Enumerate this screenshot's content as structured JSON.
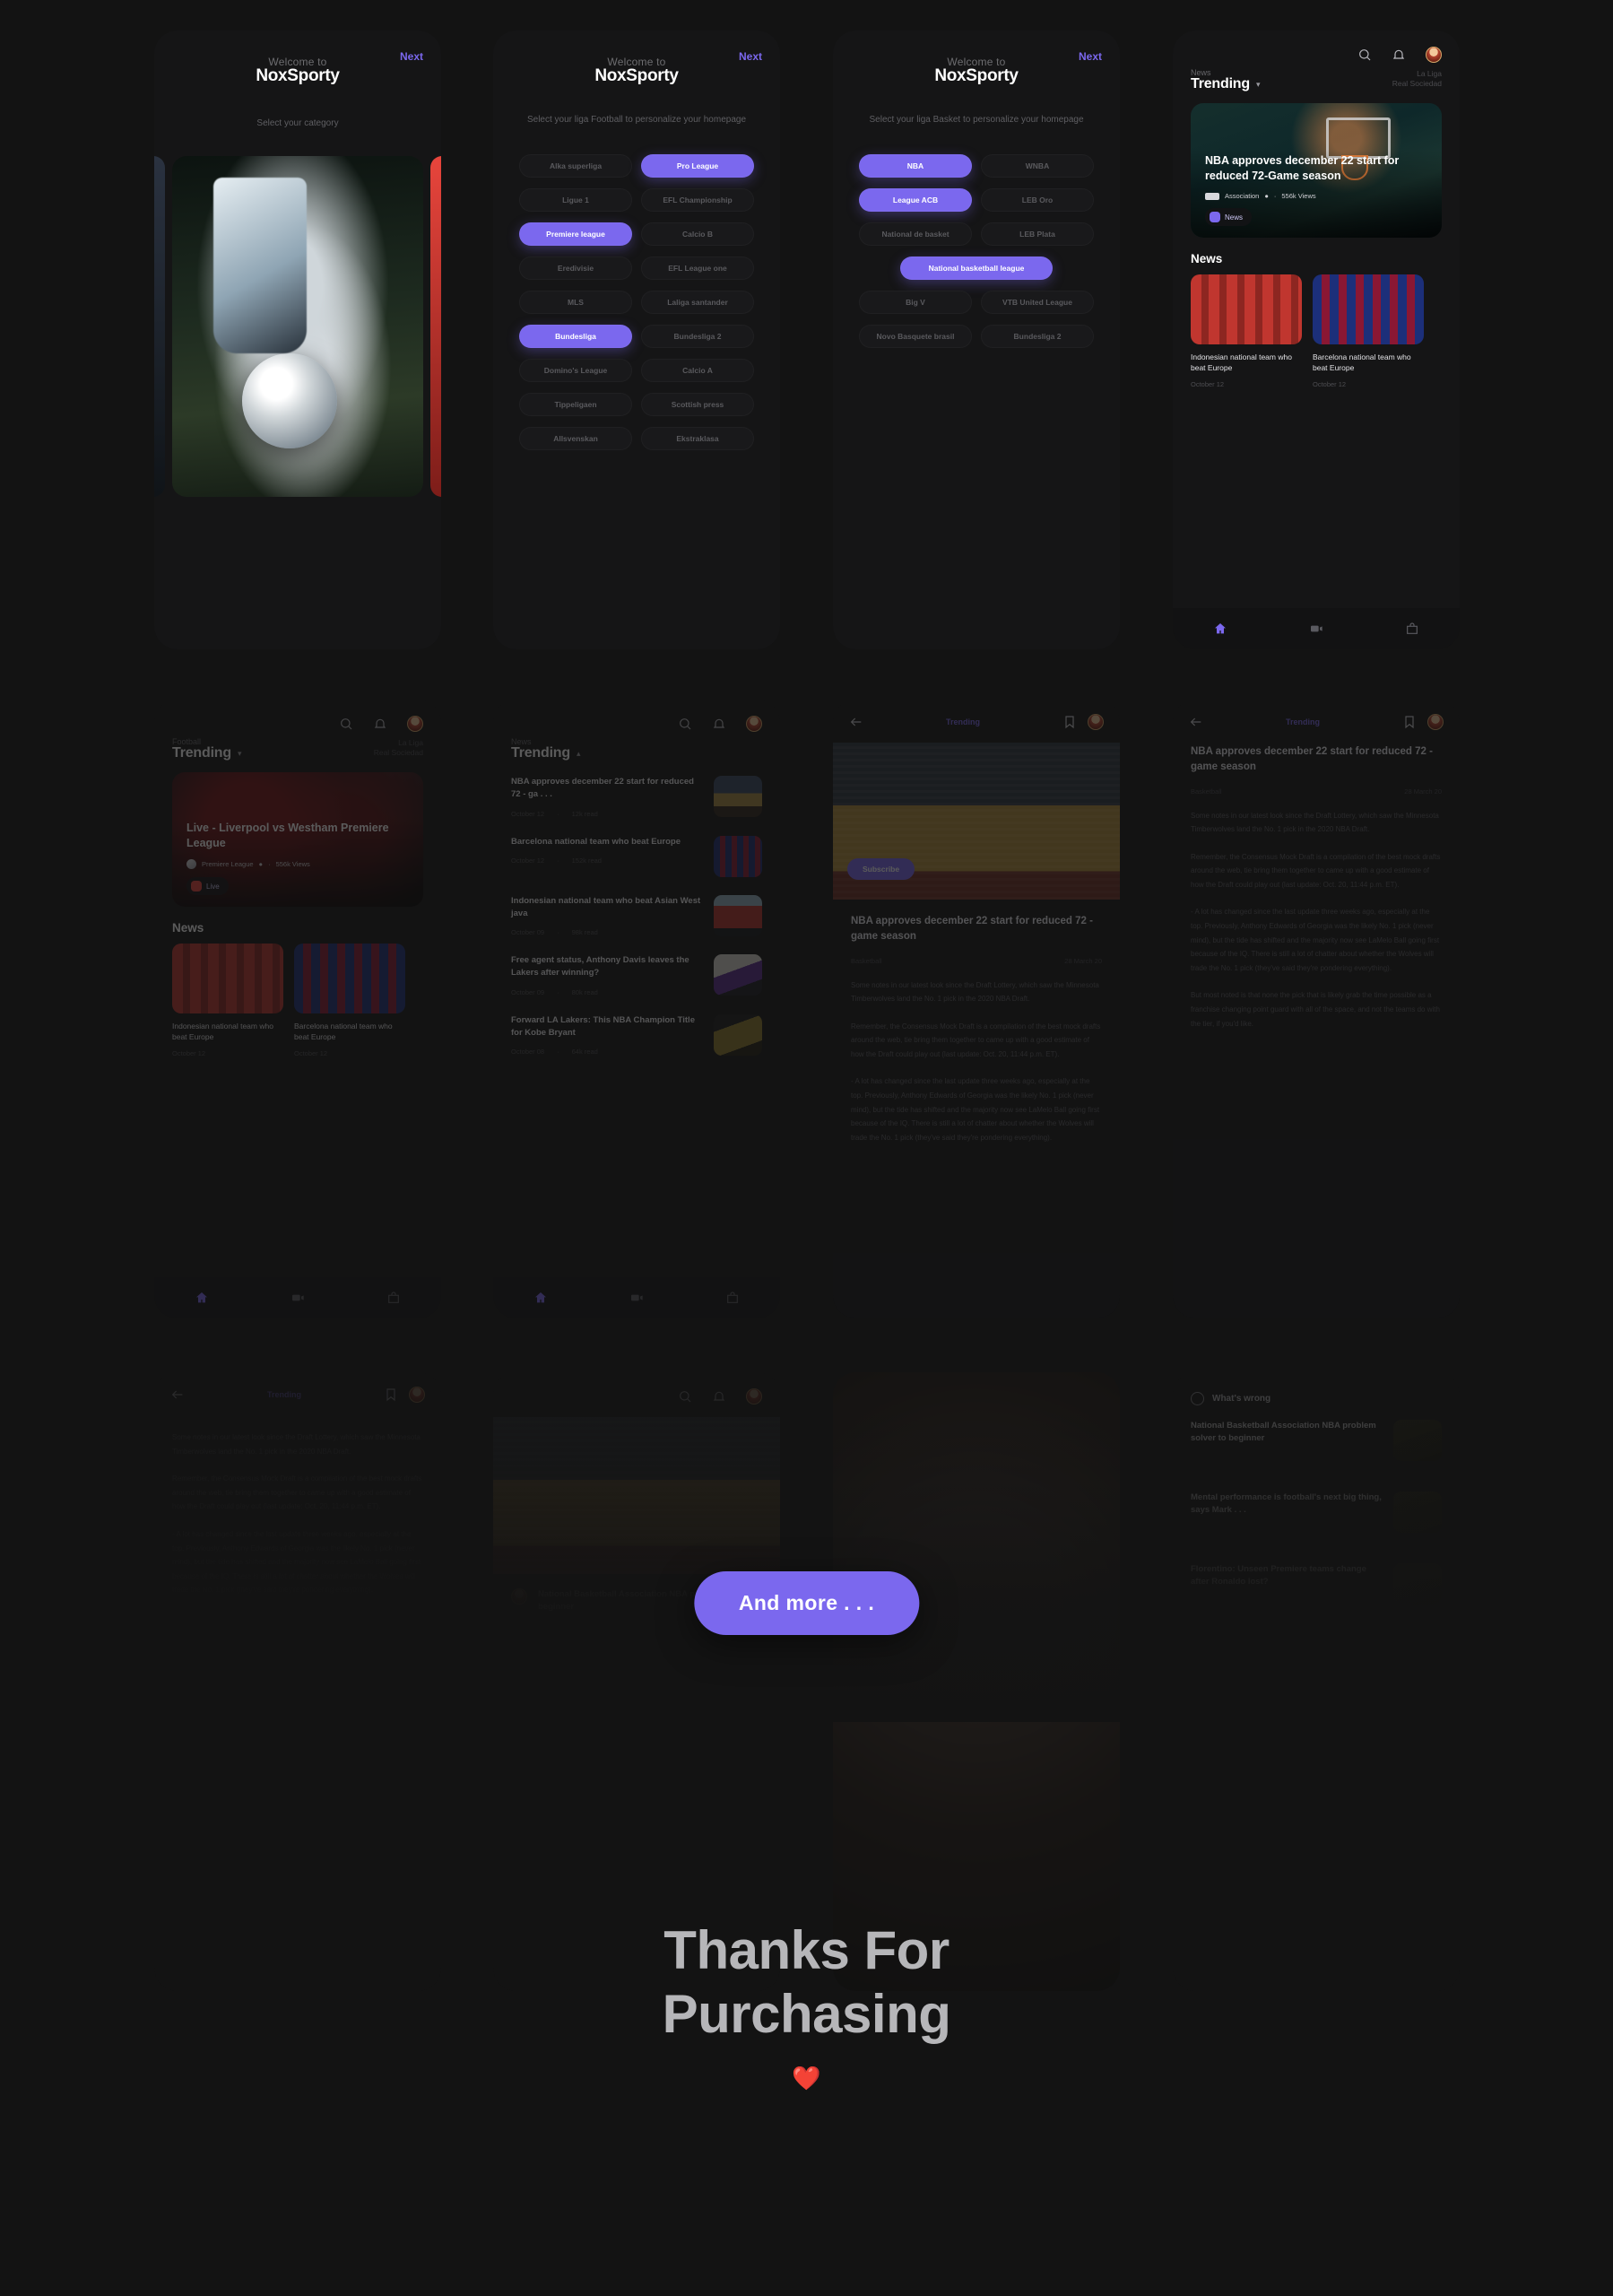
{
  "accent": "#7b68ee",
  "background": "#131313",
  "onboarding": {
    "next_label": "Next",
    "welcome_label": "Welcome to",
    "brand": "NoxSporty",
    "screen1": {
      "subtitle": "Select your category"
    },
    "screen2": {
      "subtitle": "Select your liga Football to personalize your homepage",
      "chips": [
        {
          "label": "Alka superliga",
          "selected": false
        },
        {
          "label": "Pro League",
          "selected": true
        },
        {
          "label": "Ligue 1",
          "selected": false
        },
        {
          "label": "EFL Championship",
          "selected": false
        },
        {
          "label": "Premiere league",
          "selected": true
        },
        {
          "label": "Calcio B",
          "selected": false
        },
        {
          "label": "Eredivisie",
          "selected": false
        },
        {
          "label": "EFL League one",
          "selected": false
        },
        {
          "label": "MLS",
          "selected": false
        },
        {
          "label": "Laliga santander",
          "selected": false
        },
        {
          "label": "Bundesliga",
          "selected": true
        },
        {
          "label": "Bundesliga 2",
          "selected": false
        },
        {
          "label": "Domino's League",
          "selected": false
        },
        {
          "label": "Calcio A",
          "selected": false
        },
        {
          "label": "Tippeligaen",
          "selected": false
        },
        {
          "label": "Scottish press",
          "selected": false
        },
        {
          "label": "Allsvenskan",
          "selected": false
        },
        {
          "label": "Ekstraklasa",
          "selected": false
        }
      ]
    },
    "screen3": {
      "subtitle": "Select your liga Basket to personalize your homepage",
      "chips": [
        {
          "label": "NBA",
          "selected": true
        },
        {
          "label": "WNBA",
          "selected": false
        },
        {
          "label": "League ACB",
          "selected": true
        },
        {
          "label": "LEB Oro",
          "selected": false
        },
        {
          "label": "National de basket",
          "selected": false
        },
        {
          "label": "LEB Plata",
          "selected": false
        },
        {
          "label": "National basketball league",
          "selected": true,
          "wide": true
        },
        {
          "label": "Big V",
          "selected": false
        },
        {
          "label": "VTB United League",
          "selected": false
        },
        {
          "label": "Novo Basquete brasil",
          "selected": false
        },
        {
          "label": "Bundesliga 2",
          "selected": false
        }
      ]
    }
  },
  "home_basket": {
    "kicker": "News",
    "title": "Trending",
    "league_line1": "La Liga",
    "league_line2": "Real Sociedad",
    "hero": {
      "title": "NBA approves december 22 start for reduced 72-Game season",
      "source": "Association",
      "views": "556k Views",
      "tag": "News"
    },
    "news_heading": "News",
    "news": [
      {
        "title": "Indonesian national team who beat Europe",
        "date": "October 12"
      },
      {
        "title": "Barcelona national team who beat Europe",
        "date": "October 12"
      }
    ],
    "nav": [
      "home-icon",
      "video-icon",
      "bag-icon"
    ]
  },
  "home_football": {
    "kicker": "Football",
    "title": "Trending",
    "league_line1": "La Liga",
    "league_line2": "Real Sociedad",
    "hero": {
      "title": "Live - Liverpool vs Westham Premiere League",
      "source": "Premiere League",
      "views": "556k Views",
      "tag": "Live"
    },
    "news_heading": "News",
    "news": [
      {
        "title": "Indonesian national team who beat Europe",
        "date": "October 12"
      },
      {
        "title": "Barcelona national team who beat Europe",
        "date": "October 12"
      }
    ]
  },
  "trending_list": {
    "kicker": "News",
    "title": "Trending",
    "items": [
      {
        "title": "NBA approves december 22 start for reduced 72 - ga . . .",
        "date": "October 12",
        "views": "12k read"
      },
      {
        "title": "Barcelona national team who beat Europe",
        "date": "October 12",
        "views": "152k read"
      },
      {
        "title": "Indonesian national team who beat Asian West java",
        "date": "October 09",
        "views": "98k read"
      },
      {
        "title": "Free agent status, Anthony Davis leaves the Lakers after winning?",
        "date": "October 09",
        "views": "80k read"
      },
      {
        "title": "Forward LA Lakers: This NBA Champion Title for Kobe Bryant",
        "date": "October 08",
        "views": "64k read"
      }
    ]
  },
  "article": {
    "back_label": "Trending",
    "subscribe_label": "Subscribe",
    "title": "NBA approves december 22 start for reduced 72 - game season",
    "category": "Basketball",
    "date": "28 March 20",
    "paragraphs": [
      "Some notes in our latest look since the Draft Lottery, which saw the Minnesota Timberwolves land the No. 1 pick in the 2020 NBA Draft.",
      "Remember, the Consensus Mock Draft is a compilation of the best mock drafts around the web, tie bring them together to came up with a good estimate of how the Draft could play out (last update: Oct. 20, 11:44 p.m. ET).",
      "- A lot has changed since the last update three weeks ago, especially at the top. Previously, Anthony Edwards of Georgia was the likely No. 1 pick (never mind), but the tide has shifted and the majority now see LaMelo Ball going first because of the IQ. There is still a lot of chatter about whether the Wolves will trade the No. 1 pick (they've said they're pondering everything).",
      "But most noted is that none the pick that is likely grab the time possible as a franchise changing point guard with all of the space, and not the teams do with the tier, if you'd like."
    ]
  },
  "whats_wrong": {
    "heading": "What's wrong",
    "items": [
      {
        "title": "National Basketball Association NBA problem solver to beginner"
      },
      {
        "title": "Mental performance is football's next big thing, says Mark . . ."
      },
      {
        "title": "Florentino: Unseen Premiere teams change after Ronaldo lost?"
      }
    ]
  },
  "footer": {
    "and_more_label": "And more . . .",
    "thanks_line1": "Thanks For",
    "thanks_line2": "Purchasing",
    "heart": "❤️"
  }
}
